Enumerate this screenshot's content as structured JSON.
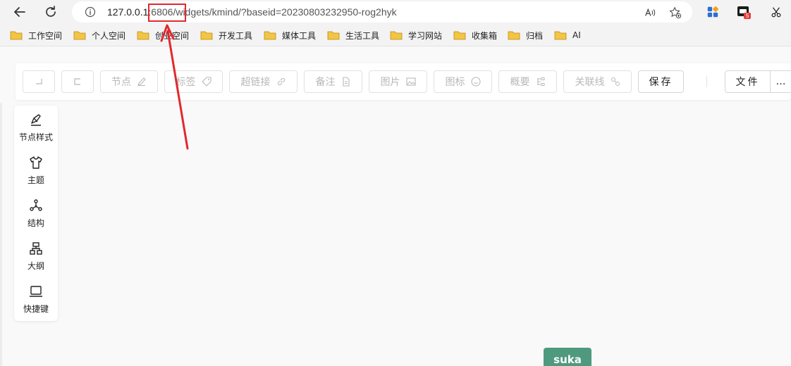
{
  "browser": {
    "url_host": "127.0.0.1",
    "url_port": ":6806",
    "url_path": "/widgets/kmind/?baseid=20230803232950-rog2hyk",
    "badge_count": "5"
  },
  "bookmarks": [
    {
      "label": "工作空间"
    },
    {
      "label": "个人空间"
    },
    {
      "label": "创业空间"
    },
    {
      "label": "开发工具"
    },
    {
      "label": "媒体工具"
    },
    {
      "label": "生活工具"
    },
    {
      "label": "学习网站"
    },
    {
      "label": "收集箱"
    },
    {
      "label": "归档"
    },
    {
      "label": "AI"
    }
  ],
  "toolbar": {
    "undo_icon": "undo-icon",
    "redo_icon": "redo-icon",
    "node_label": "节点",
    "tag_label": "标签",
    "link_label": "超链接",
    "note_label": "备注",
    "image_label": "图片",
    "icon_label": "图标",
    "summary_label": "概要",
    "relation_label": "关联线",
    "save_label": "保存",
    "file_label": "文件",
    "more_label": "…"
  },
  "sidebar": {
    "items": [
      {
        "label": "节点样式",
        "icon": "brush-icon"
      },
      {
        "label": "主题",
        "icon": "shirt-icon"
      },
      {
        "label": "结构",
        "icon": "structure-icon"
      },
      {
        "label": "大纲",
        "icon": "outline-icon"
      },
      {
        "label": "快捷键",
        "icon": "laptop-icon"
      }
    ]
  },
  "canvas": {
    "node_text": "suka"
  },
  "colors": {
    "node_bg": "#4f9a7e",
    "annotation": "#e2282e"
  }
}
